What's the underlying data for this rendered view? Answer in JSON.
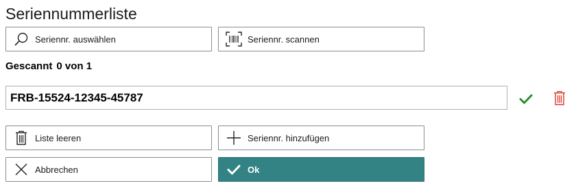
{
  "page": {
    "title": "Seriennummerliste"
  },
  "actions": {
    "select_label": "Seriennr. auswählen",
    "scan_label": "Seriennr. scannen",
    "clear_label": "Liste leeren",
    "add_label": "Seriennr. hinzufügen",
    "cancel_label": "Abbrechen",
    "ok_label": "Ok"
  },
  "scan_status": {
    "label": "Gescannt",
    "value": "0 von 1"
  },
  "serials": [
    {
      "value": "FRB-15524-12345-45787"
    }
  ],
  "colors": {
    "accent": "#338385",
    "confirm": "#2e8b2e",
    "delete": "#d9342b"
  },
  "icons": [
    "search-icon",
    "barcode-scan-icon",
    "check-icon",
    "trash-icon",
    "plus-icon",
    "close-icon"
  ]
}
